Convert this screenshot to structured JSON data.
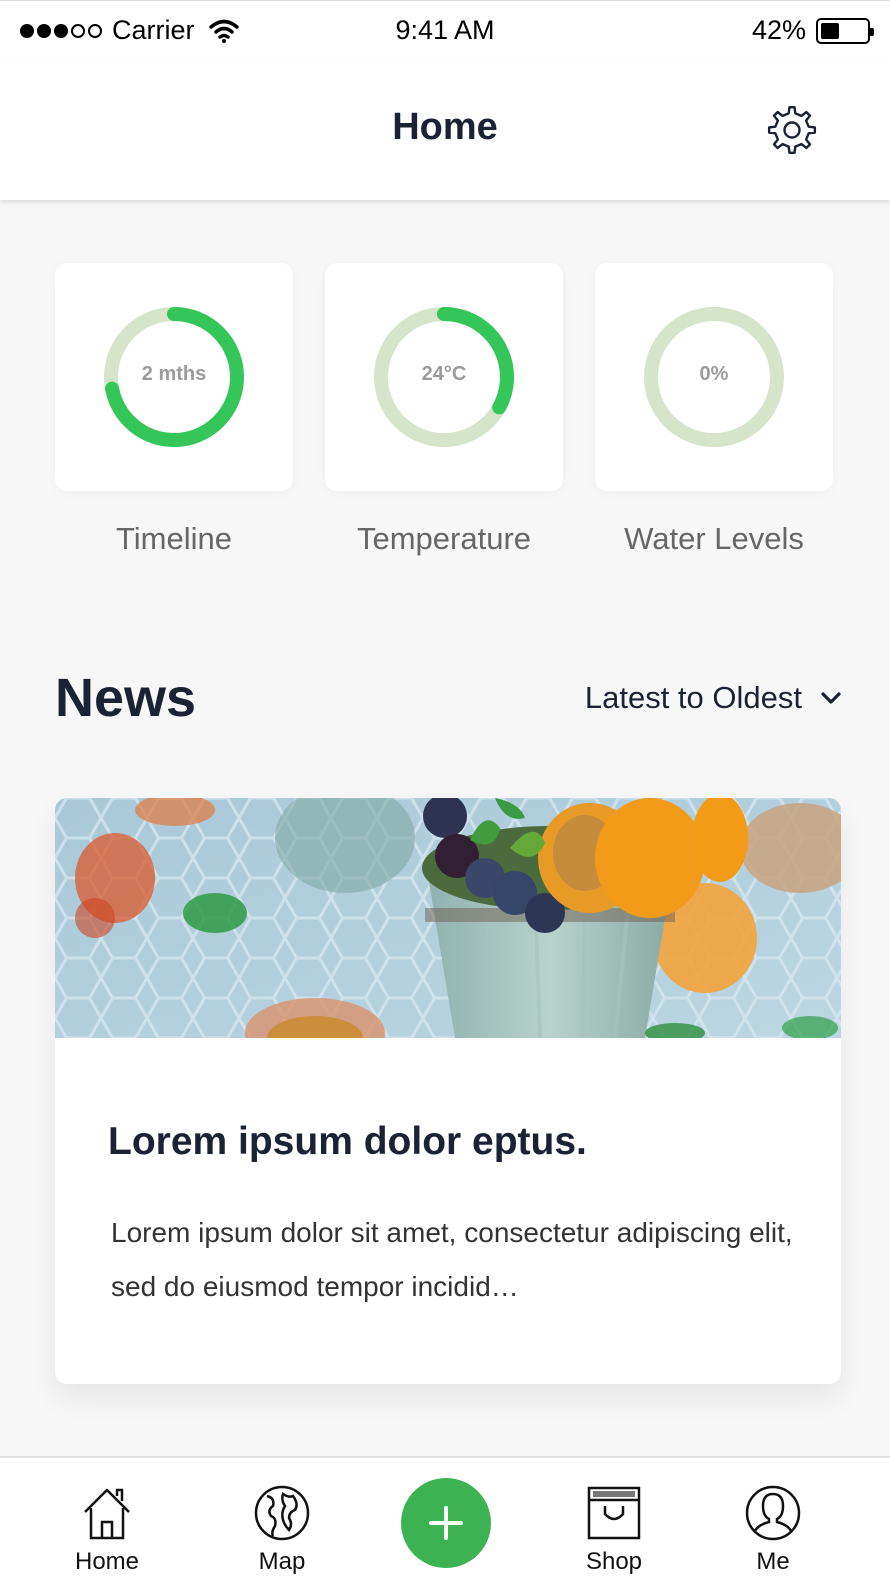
{
  "status_bar": {
    "carrier": "Carrier",
    "time": "9:41 AM",
    "battery_percent": "42%",
    "battery_level": 0.42,
    "signal_bars_filled": 3,
    "signal_bars_total": 5
  },
  "header": {
    "title": "Home",
    "settings_icon": "gear-icon"
  },
  "metrics": [
    {
      "label": "Timeline",
      "value": "2 mths",
      "progress": 0.72
    },
    {
      "label": "Temperature",
      "value": "24°C",
      "progress": 0.33
    },
    {
      "label": "Water Levels",
      "value": "0%",
      "progress": 0.0
    }
  ],
  "news": {
    "title": "News",
    "sort": {
      "selected": "Latest to Oldest",
      "icon": "chevron-down-icon"
    },
    "articles": [
      {
        "headline": "Lorem ipsum dolor eptus.",
        "excerpt": "Lorem ipsum dolor sit amet, consectetur adipiscing elit, sed do eiusmod tempor incidid…"
      }
    ]
  },
  "tab_bar": {
    "tabs": [
      {
        "label": "Home",
        "icon": "home-icon"
      },
      {
        "label": "Map",
        "icon": "globe-icon"
      },
      {
        "label": "",
        "icon": "plus-icon"
      },
      {
        "label": "Shop",
        "icon": "shopping-bag-icon"
      },
      {
        "label": "Me",
        "icon": "user-icon"
      }
    ]
  },
  "colors": {
    "accent_green": "#35c659",
    "ring_track": "#d6e5c9",
    "fab_green": "#3cb253",
    "text_dark": "#1a2233"
  }
}
